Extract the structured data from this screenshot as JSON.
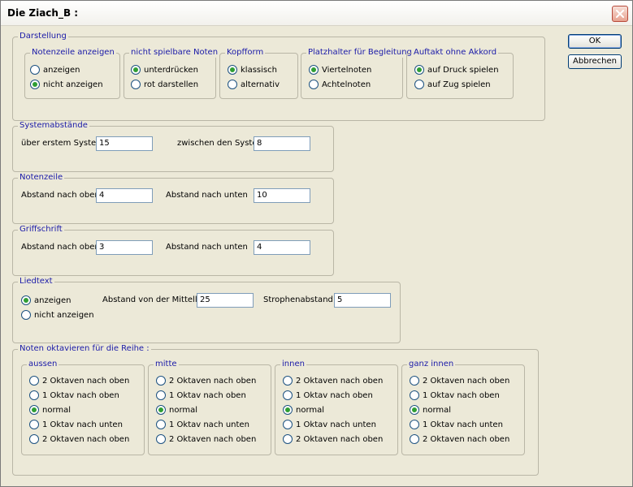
{
  "window": {
    "title": "Die Ziach_B :"
  },
  "buttons": {
    "ok": "OK",
    "cancel": "Abbrechen"
  },
  "darstellung": {
    "legend": "Darstellung",
    "notenzeile": {
      "legend": "Notenzeile anzeigen",
      "options": [
        "anzeigen",
        "nicht anzeigen"
      ],
      "selected": 1
    },
    "nicht_spielbar": {
      "legend": "nicht spielbare Noten",
      "options": [
        "unterdrücken",
        "rot darstellen"
      ],
      "selected": 0
    },
    "kopfform": {
      "legend": "Kopfform",
      "options": [
        "klassisch",
        "alternativ"
      ],
      "selected": 0
    },
    "platzhalter": {
      "legend": "Platzhalter für Begleitung",
      "options": [
        "Viertelnoten",
        "Achtelnoten"
      ],
      "selected": 0
    },
    "auftakt": {
      "legend": "Auftakt ohne Akkord",
      "options": [
        "auf Druck spielen",
        "auf Zug spielen"
      ],
      "selected": 0
    }
  },
  "systemabstaende": {
    "legend": "Systemabstände",
    "label1": "über erstem System",
    "value1": "15",
    "label2": "zwischen den Systemen",
    "value2": "8"
  },
  "notenzeile": {
    "legend": "Notenzeile",
    "label1": "Abstand nach oben",
    "value1": "4",
    "label2": "Abstand nach unten",
    "value2": "10"
  },
  "griffschrift": {
    "legend": "Griffschrift",
    "label1": "Abstand nach oben",
    "value1": "3",
    "label2": "Abstand nach unten",
    "value2": "4"
  },
  "liedtext": {
    "legend": "Liedtext",
    "options": [
      "anzeigen",
      "nicht anzeigen"
    ],
    "selected": 0,
    "label1": "Abstand von der Mittellinie",
    "value1": "25",
    "label2": "Strophenabstand",
    "value2": "5"
  },
  "oktavieren": {
    "legend": "Noten oktavieren für die Reihe :",
    "groups": [
      {
        "legend": "aussen",
        "options": [
          "2 Oktaven nach oben",
          "1 Oktav nach oben",
          "normal",
          "1 Oktav nach unten",
          "2 Oktaven nach oben"
        ],
        "selected": 2
      },
      {
        "legend": "mitte",
        "options": [
          "2 Oktaven nach oben",
          "1 Oktav nach oben",
          "normal",
          "1 Oktav nach unten",
          "2 Oktaven nach oben"
        ],
        "selected": 2
      },
      {
        "legend": "innen",
        "options": [
          "2 Oktaven nach oben",
          "1 Oktav nach oben",
          "normal",
          "1 Oktav nach unten",
          "2 Oktaven nach oben"
        ],
        "selected": 2
      },
      {
        "legend": "ganz innen",
        "options": [
          "2 Oktaven nach oben",
          "1 Oktav nach oben",
          "normal",
          "1 Oktav nach unten",
          "2 Oktaven nach oben"
        ],
        "selected": 2
      }
    ]
  }
}
